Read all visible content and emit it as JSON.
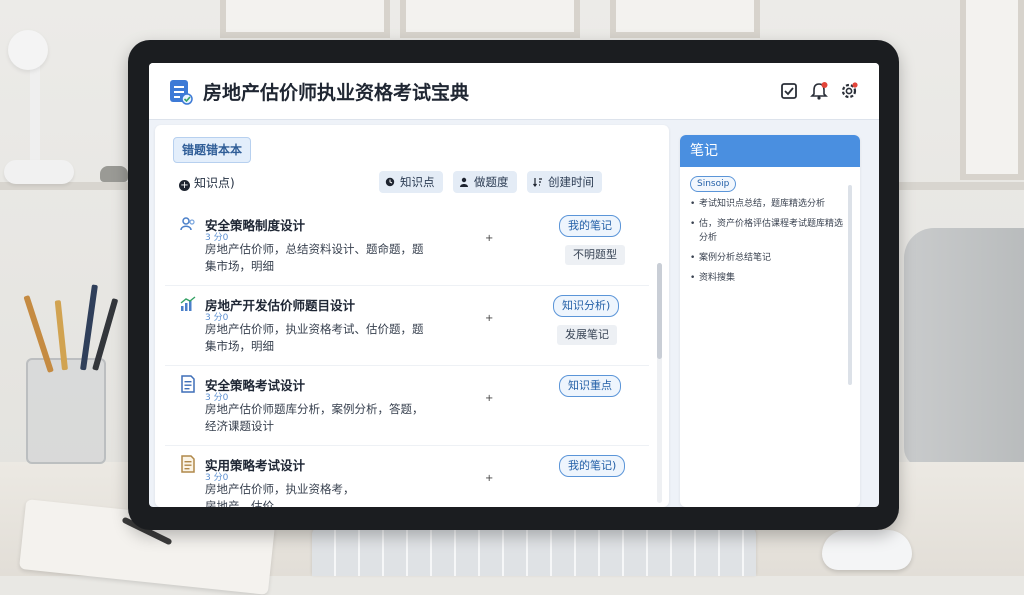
{
  "app": {
    "title": "房地产估价师执业资格考试宝典"
  },
  "main": {
    "badge": "错题错本本",
    "filter_label": "知识点)",
    "chips": [
      {
        "icon": "clock-icon",
        "label": "知识点"
      },
      {
        "icon": "user-icon",
        "label": "做题度"
      },
      {
        "icon": "sort-icon",
        "label": "创建时间"
      }
    ],
    "items": [
      {
        "icon": "people-icon",
        "icon_color": "#4a7fc9",
        "title": "安全策略制度设计",
        "sub": "3 分0",
        "desc_1": "房地产估价师，总结资料设计、题命题，题",
        "desc_2": "集市场，明细",
        "dot": "+",
        "primary": "我的笔记",
        "secondary": "不明题型"
      },
      {
        "icon": "chart-icon",
        "icon_color": "#4a7fc9",
        "title": "房地产开发估价师题目设计",
        "sub": "3 分0",
        "desc_1": "房地产估价师，执业资格考试、估价题，题",
        "desc_2": "集市场，明细",
        "dot": "+",
        "primary": "知识分析)",
        "secondary": "发展笔记"
      },
      {
        "icon": "document-icon",
        "icon_color": "#3f6fb8",
        "title": "安全策略考试设计",
        "sub": "3 分0",
        "desc_1": "房地产估价师题库分析，案例分析，答题，",
        "desc_2": "经济课题设计",
        "dot": "+",
        "primary": "知识重点"
      },
      {
        "icon": "file-icon",
        "icon_color": "#b0884a",
        "title": "实用策略考试设计",
        "sub": "3 分0",
        "desc_1": "房地产估价师，执业资格考，",
        "desc_2": "房地产，估价",
        "dot": "+",
        "primary": "我的笔记)"
      }
    ]
  },
  "notes": {
    "title": "笔记",
    "tag": "Sinsoip",
    "entries": [
      "考试知识点总结，题库精选分析",
      "估，资产价格评估课程考试题库精选分析",
      "案例分析总结笔记",
      "资料搜集"
    ]
  },
  "colors": {
    "accent": "#4a8fe0",
    "accent_border": "#5b95d8"
  }
}
